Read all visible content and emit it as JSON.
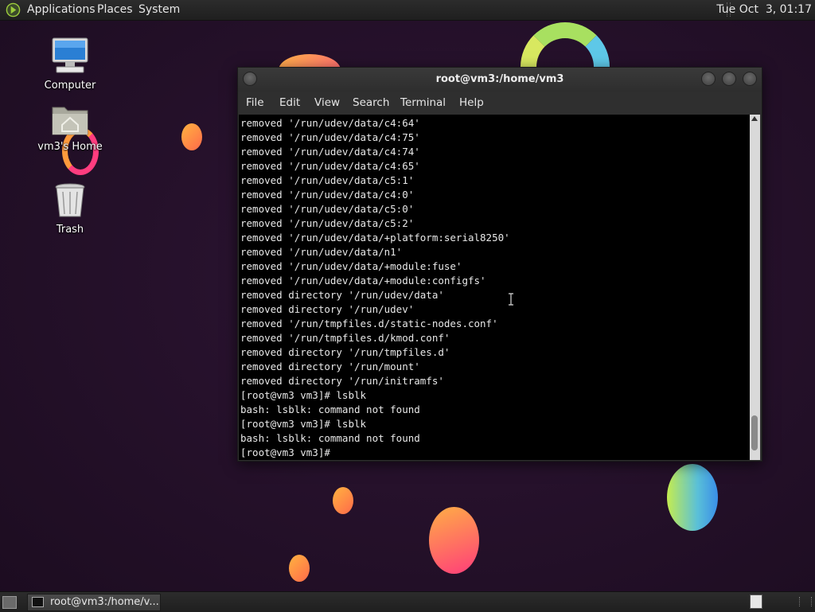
{
  "top_panel": {
    "menus": [
      "Applications",
      "Places",
      "System"
    ],
    "clock": "Tue Oct  3, 01:17"
  },
  "desktop": {
    "icons": [
      {
        "label": "Computer",
        "icon": "computer-icon"
      },
      {
        "label": "vm3's Home",
        "icon": "home-folder-icon"
      },
      {
        "label": "Trash",
        "icon": "trash-icon"
      }
    ]
  },
  "terminal": {
    "title": "root@vm3:/home/vm3",
    "menus": [
      "File",
      "Edit",
      "View",
      "Search",
      "Terminal",
      "Help"
    ],
    "lines": [
      "removed '/run/udev/data/c4:64'",
      "removed '/run/udev/data/c4:75'",
      "removed '/run/udev/data/c4:74'",
      "removed '/run/udev/data/c4:65'",
      "removed '/run/udev/data/c5:1'",
      "removed '/run/udev/data/c4:0'",
      "removed '/run/udev/data/c5:0'",
      "removed '/run/udev/data/c5:2'",
      "removed '/run/udev/data/+platform:serial8250'",
      "removed '/run/udev/data/n1'",
      "removed '/run/udev/data/+module:fuse'",
      "removed '/run/udev/data/+module:configfs'",
      "removed directory '/run/udev/data'",
      "removed directory '/run/udev'",
      "removed '/run/tmpfiles.d/static-nodes.conf'",
      "removed '/run/tmpfiles.d/kmod.conf'",
      "removed directory '/run/tmpfiles.d'",
      "removed directory '/run/mount'",
      "removed directory '/run/initramfs'",
      "[root@vm3 vm3]# lsblk",
      "bash: lsblk: command not found",
      "[root@vm3 vm3]# lsblk",
      "bash: lsblk: command not found",
      "[root@vm3 vm3]# "
    ]
  },
  "bottom_panel": {
    "task_label": "root@vm3:/home/v..."
  },
  "colors": {
    "desktop_bg": "#241029",
    "panel_bg": "#262626",
    "terminal_bg": "#000000",
    "terminal_fg": "#e8e8e8"
  }
}
